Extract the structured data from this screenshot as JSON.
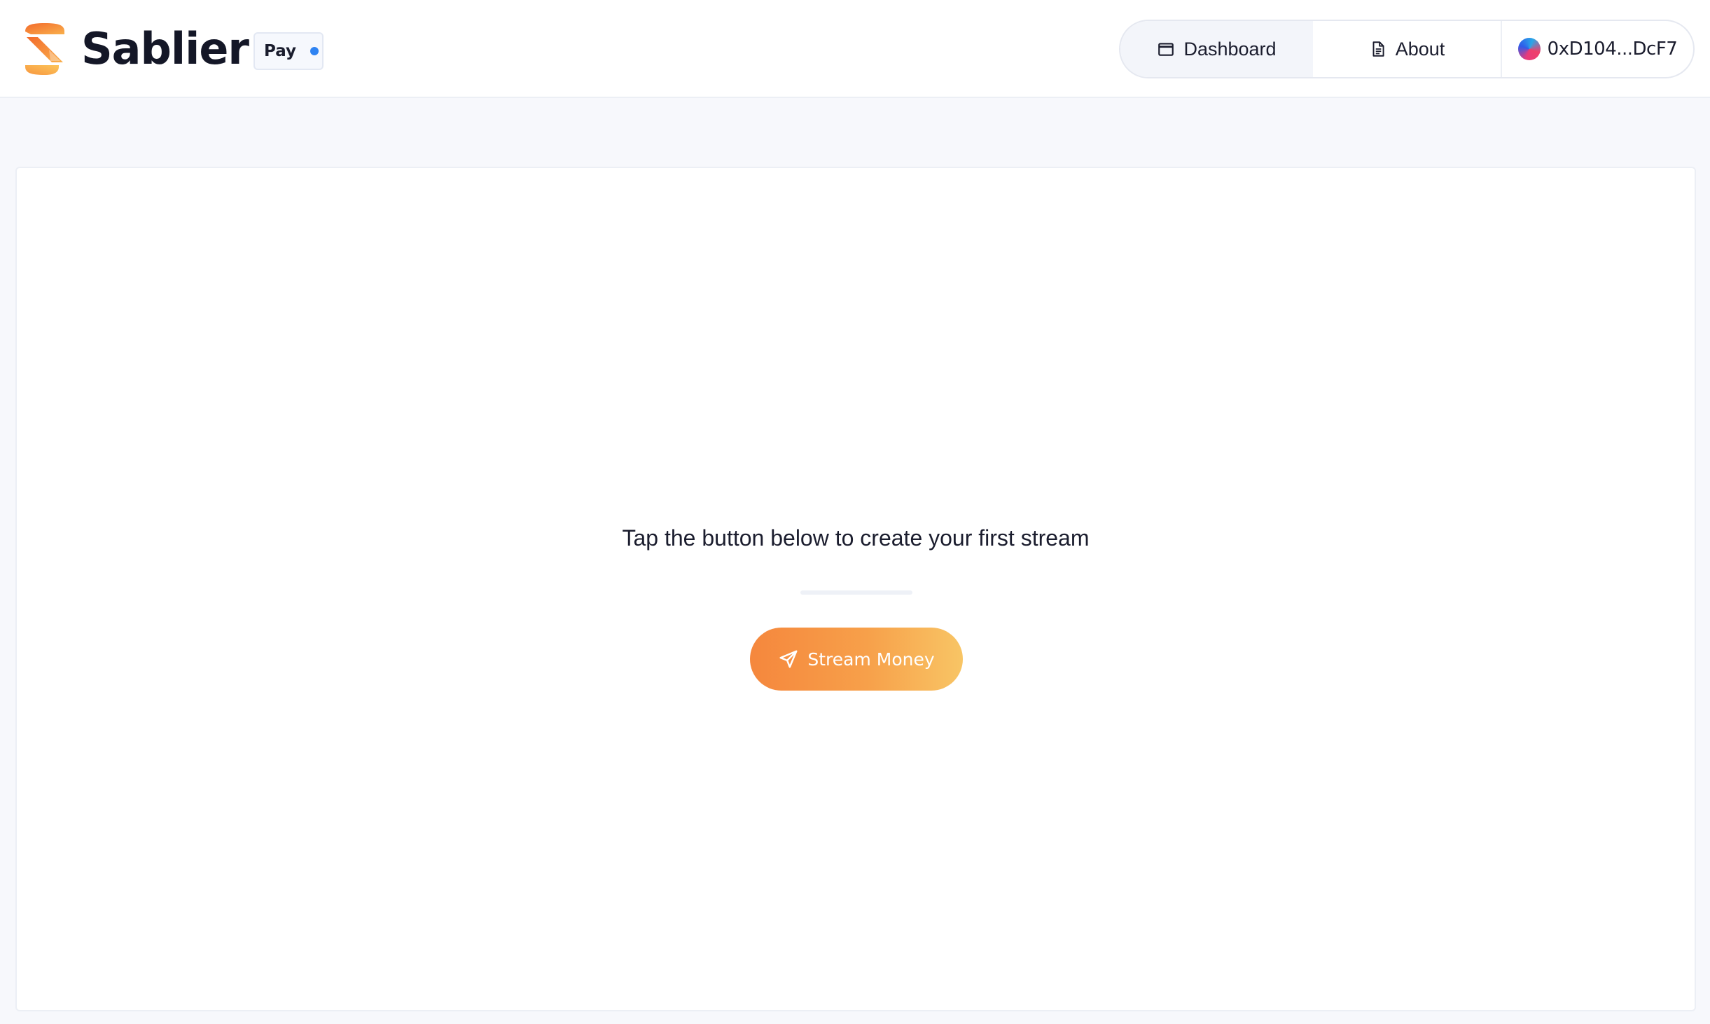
{
  "brand": {
    "name": "Sablier",
    "badge_label": "Pay"
  },
  "nav": {
    "dashboard_label": "Dashboard",
    "about_label": "About",
    "wallet_address": "0xD104...DcF7"
  },
  "main": {
    "empty_message": "Tap the button below to create your first stream",
    "cta_label": "Stream Money"
  },
  "icons": {
    "logo": "sablier-logo-icon",
    "dashboard": "window-icon",
    "about": "document-icon",
    "wallet": "wallet-avatar-icon",
    "cta": "send-icon",
    "badge_dot": "status-dot"
  },
  "colors": {
    "accent_start": "#f5873d",
    "accent_end": "#f8c565",
    "badge_dot": "#2f83f2"
  }
}
